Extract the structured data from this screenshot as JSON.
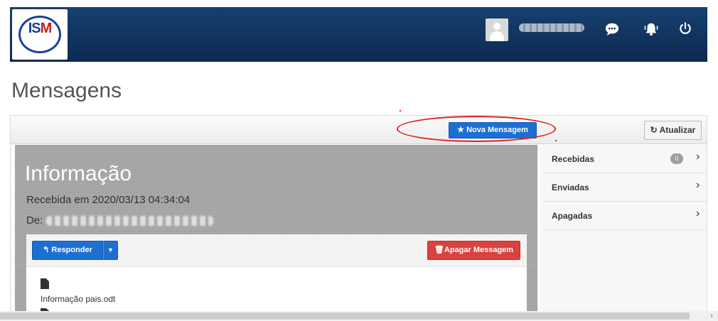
{
  "header": {
    "logo_text_left": "IS",
    "logo_text_right": "M",
    "icons": [
      "user-avatar",
      "chat-icon",
      "bell-icon",
      "power-icon"
    ]
  },
  "page": {
    "title": "Mensagens"
  },
  "toolbar": {
    "new_message_label": "Nova Mensagem",
    "refresh_label": "Atualizar"
  },
  "message": {
    "title": "Informação",
    "received": "Recebida em 2020/03/13 04:34:04",
    "from_label": "De:",
    "reply_label": "Responder",
    "delete_label": "Apagar Messagem",
    "attachments": [
      "Informação pais.odt"
    ]
  },
  "folders": [
    {
      "label": "Recebidas",
      "badge": "0"
    },
    {
      "label": "Enviadas",
      "badge": ""
    },
    {
      "label": "Apagadas",
      "badge": ""
    }
  ],
  "colors": {
    "header_bg": "#0e2e57",
    "primary_button": "#1d6fd2",
    "danger_button": "#d9423e",
    "annotation": "#e02020"
  }
}
